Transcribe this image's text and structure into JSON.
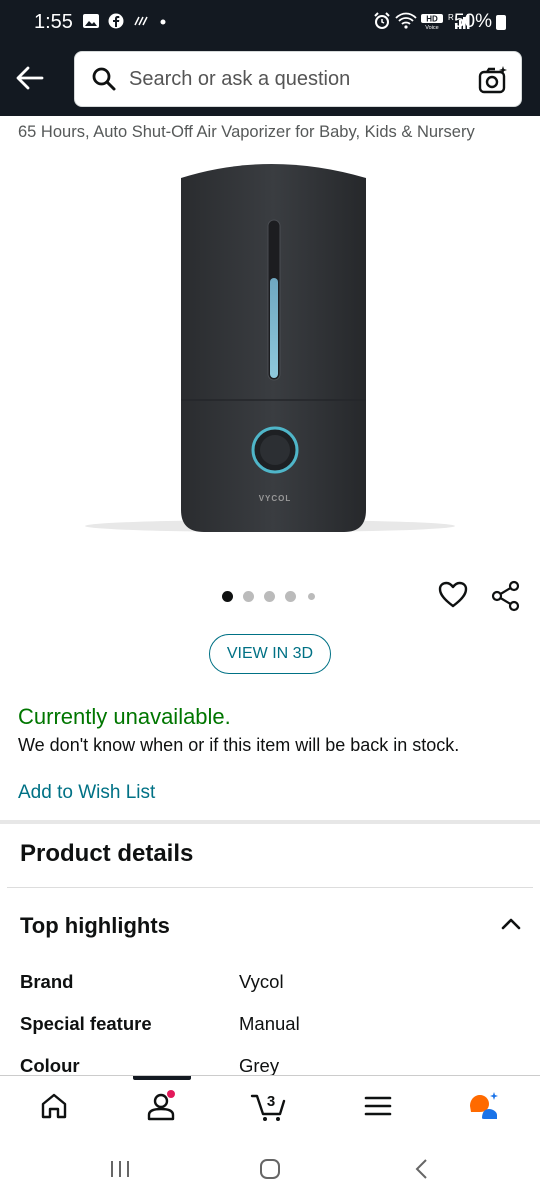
{
  "status_bar": {
    "time": "1:55",
    "left_icons": [
      "gallery-icon",
      "facebook-icon",
      "missed-call-icon",
      "dot"
    ],
    "right_icons": [
      "alarm-icon",
      "wifi-icon",
      "hd-voice-icon",
      "signal-icon"
    ],
    "battery": "50%"
  },
  "search": {
    "placeholder": "Search or ask a question"
  },
  "product": {
    "title_partial": "65 Hours, Auto Shut-Off Air Vaporizer for Baby, Kids & Nursery",
    "brand_mark": "VYCOL",
    "image_count": 5,
    "active_image": 1
  },
  "actions": {
    "view_3d": "VIEW IN 3D"
  },
  "availability": {
    "status": "Currently unavailable.",
    "message": "We don't know when or if this item will be back in stock.",
    "wishlist_link": "Add to Wish List"
  },
  "details": {
    "section_title": "Product details",
    "highlights_title": "Top highlights",
    "rows": [
      {
        "label": "Brand",
        "value": "Vycol"
      },
      {
        "label": "Special feature",
        "value": "Manual"
      },
      {
        "label": "Colour",
        "value": "Grey"
      }
    ]
  },
  "bottom_nav": {
    "cart_count": "3",
    "items": [
      "home-icon",
      "account-icon",
      "cart-icon",
      "menu-icon",
      "rufus-icon"
    ]
  },
  "colors": {
    "header_bg": "#131921",
    "link": "#007185",
    "available_green": "#007600",
    "badge": "#e3195a"
  }
}
